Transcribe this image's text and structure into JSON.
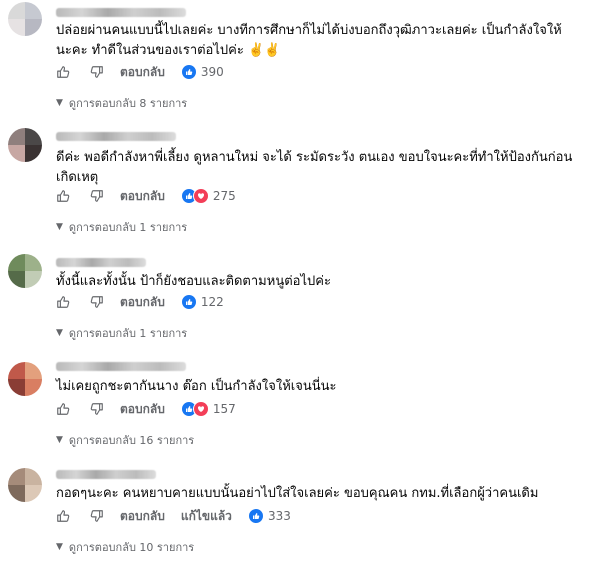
{
  "comments": [
    {
      "text": "ปล่อยผ่านคนแบบนี้ไปเลยค่ะ บางทีการศึกษาก็ไม่ได้บ่งบอกถึงวุฒิภาวะเลยค่ะ เป็นกำลังใจให้นะคะ ทำดีในส่วนของเราต่อไปค่ะ ✌️✌️",
      "reply_label": "ตอบกลับ",
      "reaction_count": "390",
      "reactions": [
        "like"
      ],
      "replies_label": "ดูการตอบกลับ 8 รายการ",
      "avatar_colors": [
        "#d9d9d9",
        "#c6c9d1",
        "#e6e2e3",
        "#b7b8c2"
      ]
    },
    {
      "text": "ดีค่ะ พอดีกำลังหาพี่เลี้ยง ดูหลานใหม่ จะได้ ระมัดระวัง ตนเอง ขอบใจนะคะที่ทำให้ป้องกันก่อนเกิดเหตุ",
      "reply_label": "ตอบกลับ",
      "reaction_count": "275",
      "reactions": [
        "like",
        "love"
      ],
      "replies_label": "ดูการตอบกลับ 1 รายการ",
      "avatar_colors": [
        "#8f7f7d",
        "#4b4848",
        "#c7a7a3",
        "#3a3232"
      ]
    },
    {
      "text": "ทั้งนี้และทั้งนั้น ป้าก็ยังชอบและติดตามหนูต่อไปค่ะ",
      "reply_label": "ตอบกลับ",
      "reaction_count": "122",
      "reactions": [
        "like"
      ],
      "replies_label": "ดูการตอบกลับ 1 รายการ",
      "avatar_colors": [
        "#6f8b5c",
        "#9db18a",
        "#556b49",
        "#c1ccb5"
      ]
    },
    {
      "text": "ไม่เคยถูกชะตากันนาง ต๊อก เป็นกำลังใจให้เจนนี่นะ",
      "reply_label": "ตอบกลับ",
      "reaction_count": "157",
      "reactions": [
        "like",
        "love"
      ],
      "replies_label": "ดูการตอบกลับ 16 รายการ",
      "avatar_colors": [
        "#c0594a",
        "#e3a07d",
        "#8a3d35",
        "#d97e62"
      ]
    },
    {
      "text": "กอดๆนะคะ คนหยาบคายแบบนั้นอย่าไปใส่ใจเลยค่ะ ขอบคุณคน กทม.ที่เลือกผู้ว่าคนเดิม",
      "reply_label": "ตอบกลับ",
      "edit_label": "แก้ไขแล้ว",
      "reaction_count": "333",
      "reactions": [
        "like"
      ],
      "replies_label": "ดูการตอบกลับ 10 รายการ",
      "avatar_colors": [
        "#a58b7a",
        "#c9b3a0",
        "#7e6a5c",
        "#dcc8b6"
      ]
    }
  ]
}
